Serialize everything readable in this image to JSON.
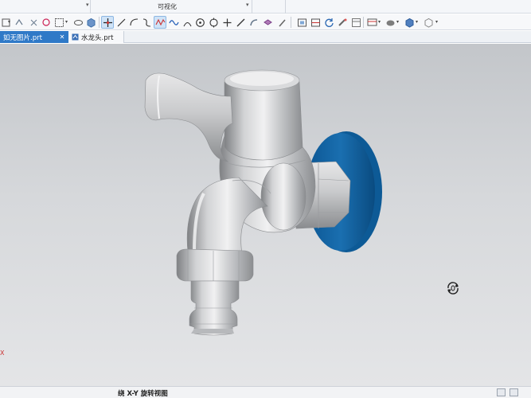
{
  "ribbon": {
    "group_label": "可视化"
  },
  "toolbar": {
    "icons": [
      "undo-icon",
      "snap-icon",
      "selection-box-icon",
      "view-orient-icon",
      "cube-icon",
      "move-icon",
      "line-icon",
      "arc-icon",
      "spline-icon",
      "sketch-curve-icon",
      "angle-icon",
      "circle-point-icon",
      "plus-icon",
      "line-tool-icon",
      "curve-tool-icon",
      "layer-icon",
      "view-fit-icon",
      "view-section-icon",
      "refresh-icon",
      "paint-icon",
      "layout-icon",
      "display-icon",
      "render-icon",
      "shaded-icon",
      "wireframe-icon"
    ]
  },
  "tabs": [
    {
      "label": "如无图片.prt",
      "active": true
    },
    {
      "label": "水龙头.prt",
      "active": false
    }
  ],
  "viewport": {
    "axis_label": "X"
  },
  "status": {
    "text": "绕 X-Y 旋转视图"
  }
}
